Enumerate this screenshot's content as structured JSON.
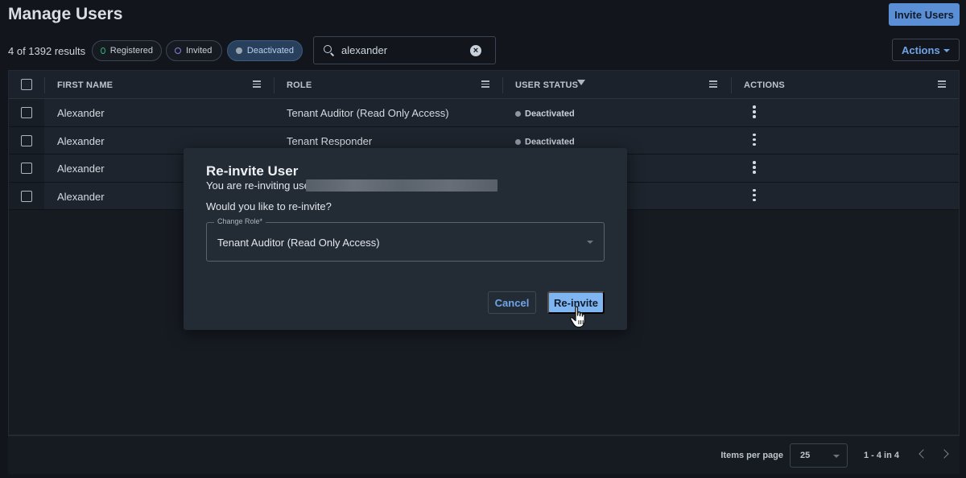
{
  "header": {
    "title": "Manage Users",
    "invite_button": "Invite Users"
  },
  "toolbar": {
    "results": "4 of 1392 results",
    "chips": [
      {
        "label": "Registered",
        "color": "#2fb37a",
        "active": false
      },
      {
        "label": "Invited",
        "color": "#8a7ee0",
        "active": false
      },
      {
        "label": "Deactivated",
        "color": "#9aa4b0",
        "active": true
      }
    ],
    "search_value": "alexander",
    "actions_label": "Actions"
  },
  "table": {
    "columns": [
      "FIRST NAME",
      "ROLE",
      "USER STATUS",
      "ACTIONS"
    ],
    "rows": [
      {
        "first_name": "Alexander",
        "role": "Tenant Auditor (Read Only Access)",
        "status": "Deactivated"
      },
      {
        "first_name": "Alexander",
        "role": "Tenant Responder",
        "status": "Deactivated"
      },
      {
        "first_name": "Alexander",
        "role": "",
        "status": ""
      },
      {
        "first_name": "Alexander",
        "role": "",
        "status": ""
      }
    ]
  },
  "footer": {
    "items_per_page_label": "Items per page",
    "items_per_page": "25",
    "range": "1 - 4 in 4"
  },
  "modal": {
    "title": "Re-invite User",
    "subtitle": "You are re-inviting user",
    "question": "Would you like to re-invite?",
    "role_label": "Change Role",
    "role_required": "*",
    "role_value": "Tenant Auditor (Read Only Access)",
    "cancel_label": "Cancel",
    "confirm_label": "Re-invite"
  },
  "colors": {
    "accent": "#6fa4e8",
    "primary_button": "#5a8fd6",
    "confirm_button": "#7fb6f2"
  }
}
